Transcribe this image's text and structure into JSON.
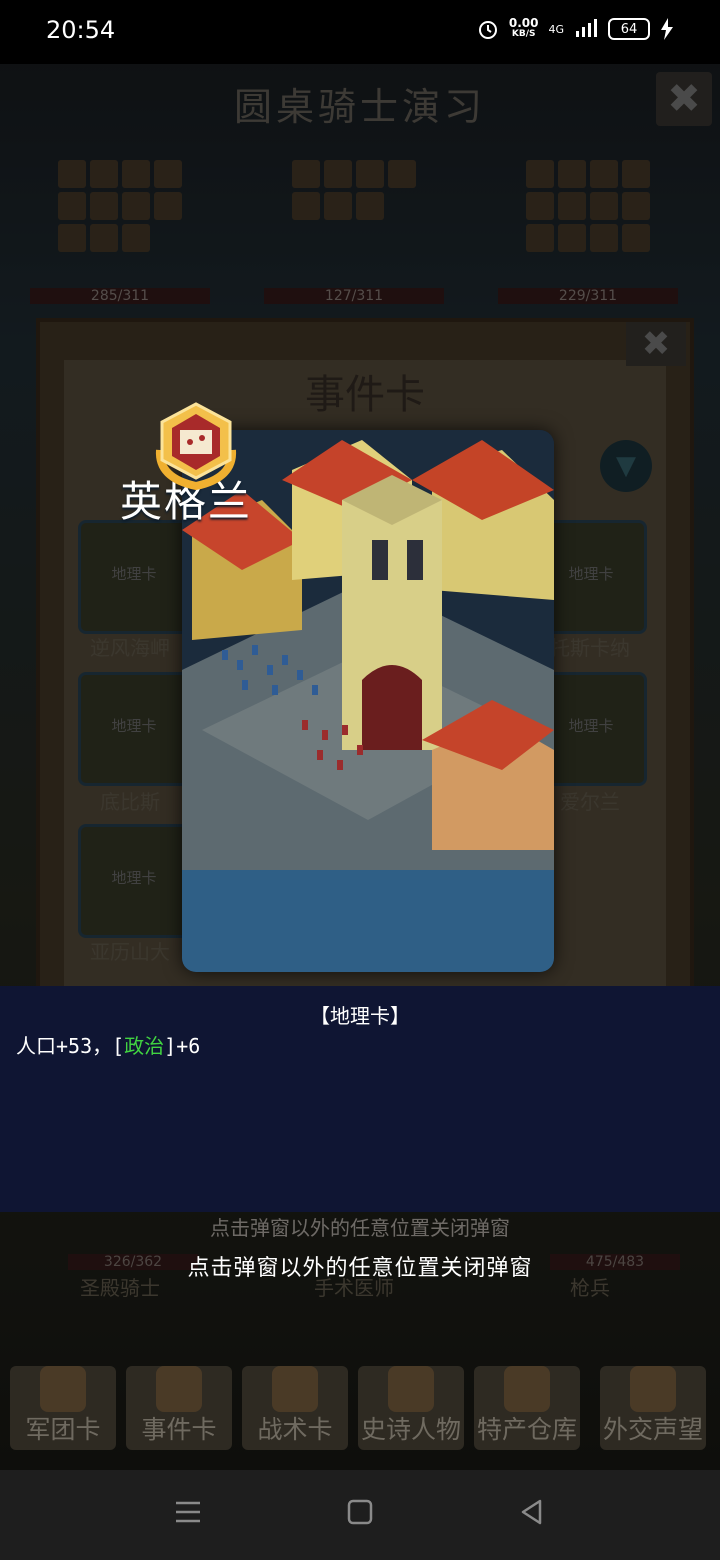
{
  "status_bar": {
    "time": "20:54",
    "speed_value": "0.00",
    "speed_unit": "KB/S",
    "network": "4G",
    "battery": "64"
  },
  "background": {
    "title": "圆桌骑士演习",
    "units_top": [
      {
        "hp": "285/311"
      },
      {
        "hp": "127/311"
      },
      {
        "hp": "229/311"
      }
    ],
    "panel_title": "事件卡",
    "cards": [
      {
        "type": "地理卡",
        "name": "逆风海岬"
      },
      {
        "type": "地理卡",
        "name": "托斯卡纳"
      },
      {
        "type": "地理卡",
        "name": "底比斯"
      },
      {
        "type": "地理卡",
        "name": "爱尔兰"
      },
      {
        "type": "地理卡",
        "name": "亚历山大"
      }
    ],
    "units_bottom": [
      {
        "hp": "326/362",
        "name": "圣殿骑士"
      },
      {
        "hp": "",
        "name": "手术医师"
      },
      {
        "hp": "475/483",
        "name": "枪兵"
      }
    ],
    "hint_ghost": "点击弹窗以外的任意位置关闭弹窗",
    "tabs": [
      "军团卡",
      "事件卡",
      "战术卡",
      "史诗人物",
      "特产仓库",
      "外交声望"
    ]
  },
  "dialog": {
    "card_name": "英格兰",
    "card_type": "【地理卡】",
    "effect_prefix": "人口+53，[",
    "effect_keyword": "政治",
    "effect_suffix": "]+6"
  },
  "hint": "点击弹窗以外的任意位置关闭弹窗",
  "colors": {
    "desc_panel": "#0f1533",
    "keyword": "#41d441",
    "name_bar": "#2f5f86"
  }
}
